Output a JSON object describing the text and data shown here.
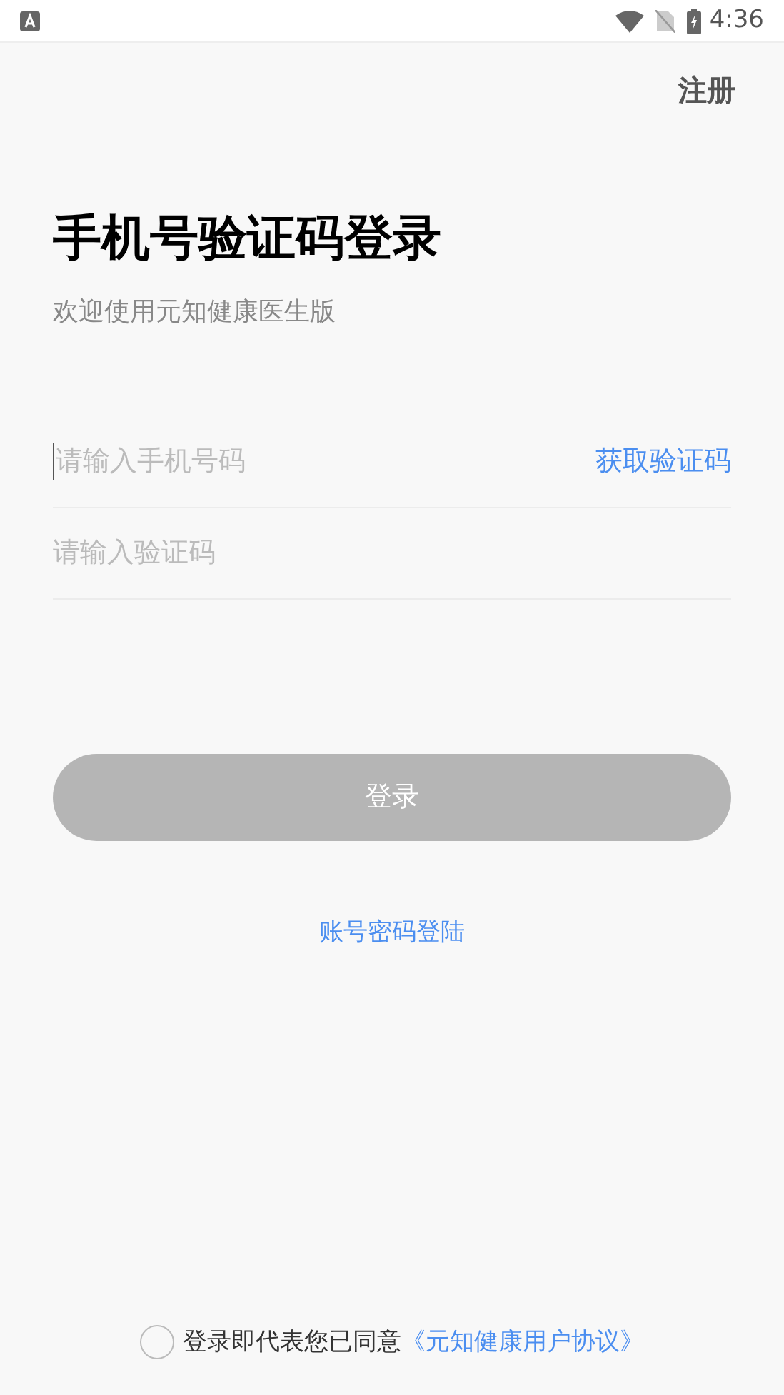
{
  "status_bar": {
    "time": "4:36"
  },
  "header": {
    "register": "注册"
  },
  "title": "手机号验证码登录",
  "subtitle": "欢迎使用元知健康医生版",
  "phone_field": {
    "placeholder": "请输入手机号码",
    "action": "获取验证码"
  },
  "code_field": {
    "placeholder": "请输入验证码"
  },
  "login_button": {
    "label": "登录",
    "disabled": true
  },
  "password_login_link": "账号密码登陆",
  "agreement": {
    "checked": false,
    "text": "登录即代表您已同意",
    "link": "《元知健康用户协议》"
  }
}
